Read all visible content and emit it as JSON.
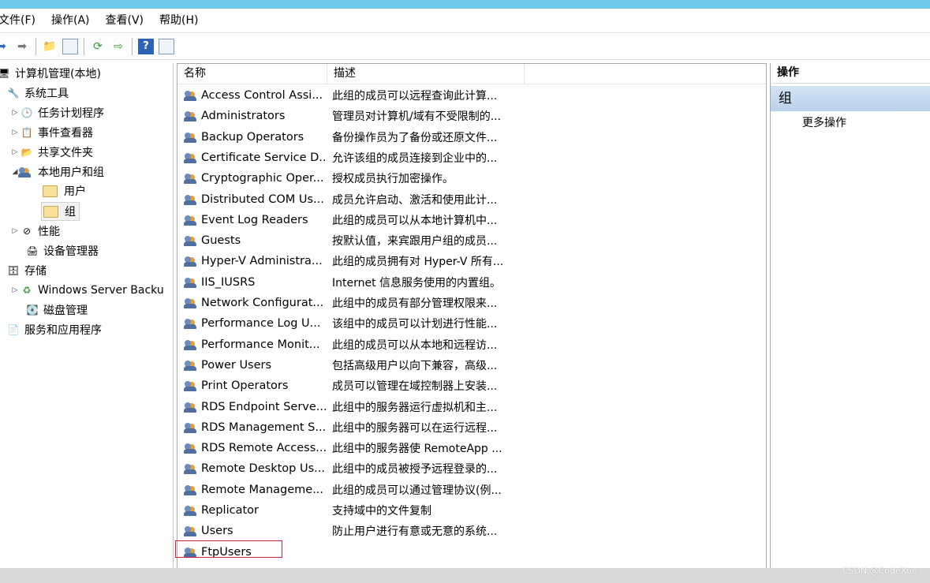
{
  "menu": [
    "文件(F)",
    "操作(A)",
    "查看(V)",
    "帮助(H)"
  ],
  "toolbar": {
    "icons": [
      "back-arrow-icon",
      "forward-arrow-icon",
      "up-folder-icon",
      "show-hide-tree-icon",
      "refresh-icon",
      "export-list-icon",
      "help-icon",
      "show-hide-action-pane-icon"
    ]
  },
  "tree": {
    "root": "计算机管理(本地)",
    "system_tools": "系统工具",
    "task_scheduler": "任务计划程序",
    "event_viewer": "事件查看器",
    "shared_folders": "共享文件夹",
    "local_users_groups": "本地用户和组",
    "users": "用户",
    "groups": "组",
    "performance": "性能",
    "device_manager": "设备管理器",
    "storage": "存储",
    "windows_server_backup": "Windows Server Backu",
    "disk_management": "磁盘管理",
    "services_apps": "服务和应用程序"
  },
  "list": {
    "columns": [
      "名称",
      "描述"
    ],
    "rows": [
      {
        "name": "Access Control Assi...",
        "desc": "此组的成员可以远程查询此计算..."
      },
      {
        "name": "Administrators",
        "desc": "管理员对计算机/域有不受限制的..."
      },
      {
        "name": "Backup Operators",
        "desc": "备份操作员为了备份或还原文件..."
      },
      {
        "name": "Certificate Service D...",
        "desc": "允许该组的成员连接到企业中的..."
      },
      {
        "name": "Cryptographic Oper...",
        "desc": "授权成员执行加密操作。"
      },
      {
        "name": "Distributed COM Us...",
        "desc": "成员允许启动、激活和使用此计..."
      },
      {
        "name": "Event Log Readers",
        "desc": "此组的成员可以从本地计算机中..."
      },
      {
        "name": "Guests",
        "desc": "按默认值，来宾跟用户组的成员..."
      },
      {
        "name": "Hyper-V Administra...",
        "desc": "此组的成员拥有对 Hyper-V 所有..."
      },
      {
        "name": "IIS_IUSRS",
        "desc": "Internet 信息服务使用的内置组。"
      },
      {
        "name": "Network Configurat...",
        "desc": "此组中的成员有部分管理权限来..."
      },
      {
        "name": "Performance Log U...",
        "desc": "该组中的成员可以计划进行性能..."
      },
      {
        "name": "Performance Monit...",
        "desc": "此组的成员可以从本地和远程访..."
      },
      {
        "name": "Power Users",
        "desc": "包括高级用户以向下兼容，高级..."
      },
      {
        "name": "Print Operators",
        "desc": "成员可以管理在域控制器上安装..."
      },
      {
        "name": "RDS Endpoint Serve...",
        "desc": "此组中的服务器运行虚拟机和主..."
      },
      {
        "name": "RDS Management S...",
        "desc": "此组中的服务器可以在运行远程..."
      },
      {
        "name": "RDS Remote Access...",
        "desc": "此组中的服务器使 RemoteApp ..."
      },
      {
        "name": "Remote Desktop Us...",
        "desc": "此组中的成员被授予远程登录的..."
      },
      {
        "name": "Remote Manageme...",
        "desc": "此组的成员可以通过管理协议(例..."
      },
      {
        "name": "Replicator",
        "desc": "支持域中的文件复制"
      },
      {
        "name": "Users",
        "desc": "防止用户进行有意或无意的系统..."
      },
      {
        "name": "FtpUsers",
        "desc": ""
      }
    ]
  },
  "actions": {
    "header": "操作",
    "section": "组",
    "more": "更多操作"
  },
  "watermark": "CSDN @CodeXue",
  "colors": {
    "titlebar": "#6fc8e8",
    "highlight_border": "#d0263a",
    "action_section": "#c6dbef"
  }
}
